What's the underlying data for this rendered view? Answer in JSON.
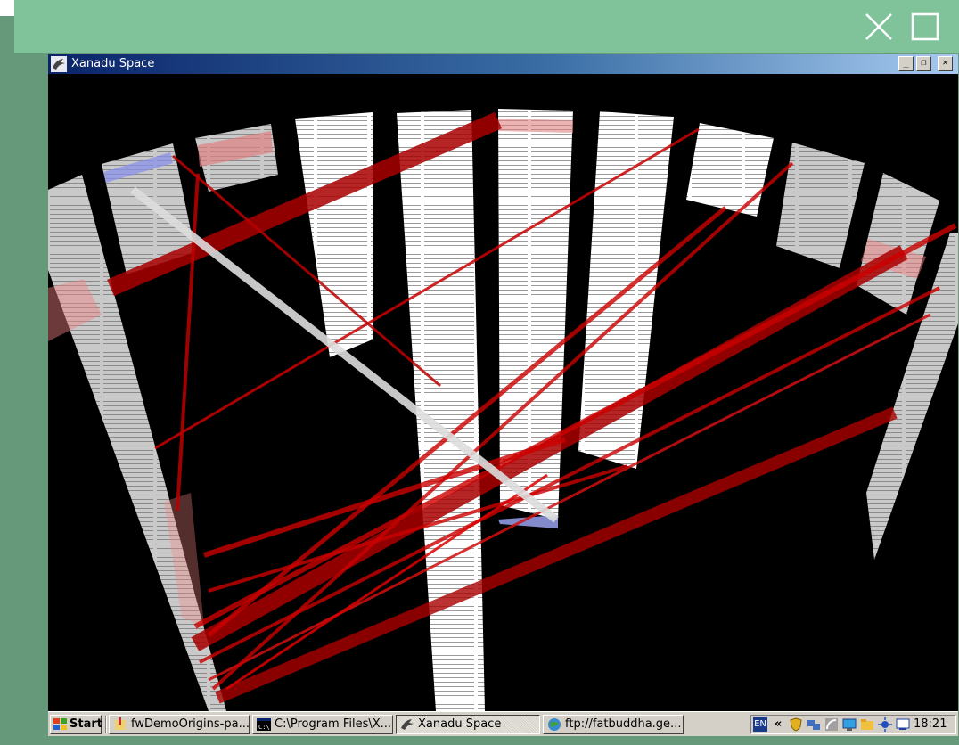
{
  "window": {
    "title": "Xanadu Space",
    "minimize_label": "_",
    "restore_label": "❐",
    "close_label": "✕"
  },
  "taskbar": {
    "start_label": "Start",
    "tasks": [
      {
        "label": "fwDemoOrigins-pa..."
      },
      {
        "label": "C:\\Program Files\\X..."
      },
      {
        "label": "Xanadu Space"
      },
      {
        "label": "ftp://fatbuddha.ge..."
      }
    ],
    "language": "EN",
    "chevron": "«",
    "clock": "18:21"
  },
  "colors": {
    "frame_green": "#80c39b",
    "link_red": "#cc1111",
    "link_white": "#dddddd",
    "highlight_blue": "#9aa2ee"
  }
}
